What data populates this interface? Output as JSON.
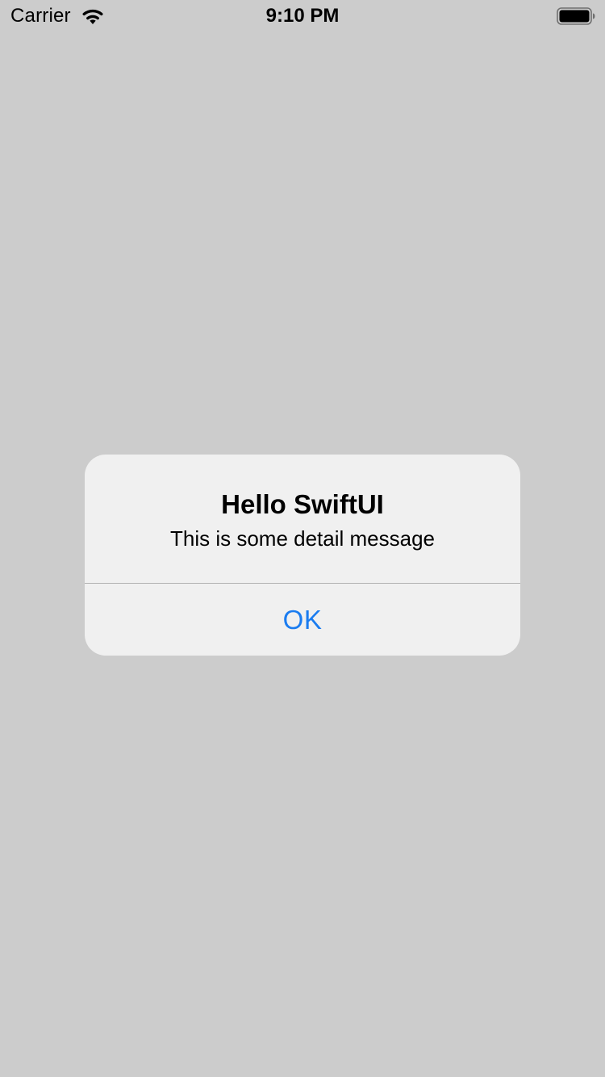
{
  "status_bar": {
    "carrier": "Carrier",
    "time": "9:10 PM",
    "wifi_icon": "wifi-icon",
    "battery_icon": "battery-icon"
  },
  "alert": {
    "title": "Hello SwiftUI",
    "message": "This is some detail message",
    "button_label": "OK"
  },
  "colors": {
    "background": "#cccccc",
    "alert_background": "#f0f0f0",
    "accent": "#1a7cf0",
    "divider": "#b3b3b3"
  }
}
